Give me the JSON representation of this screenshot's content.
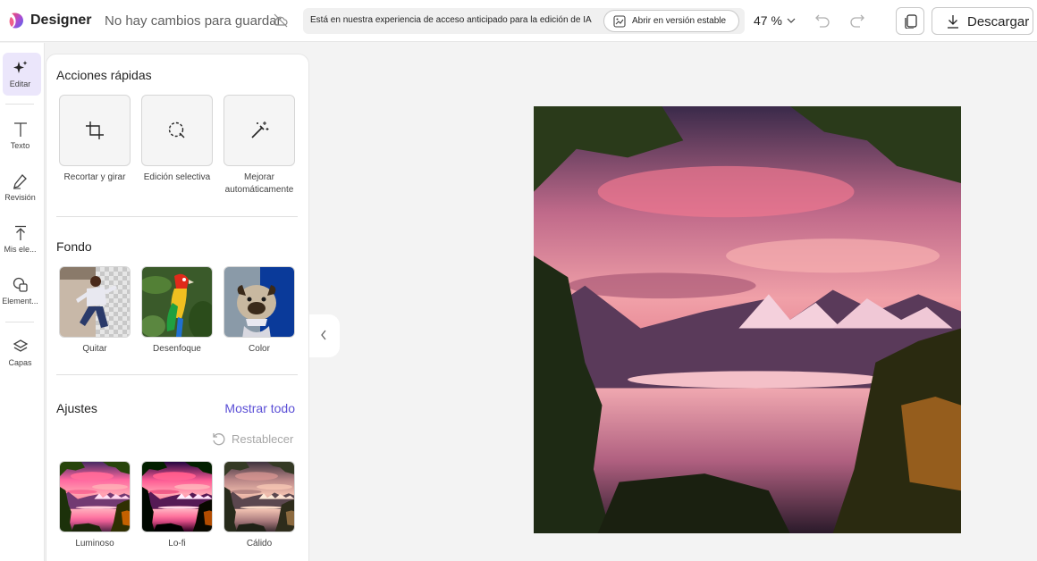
{
  "header": {
    "app_name": "Designer",
    "save_status": "No hay cambios para guardar",
    "notice_text": "Está en nuestra experiencia de acceso anticipado para la edición de IA",
    "stable_button": "Abrir en versión estable",
    "zoom": "47 %",
    "download": "Descargar"
  },
  "rail": {
    "items": [
      {
        "label": "Editar",
        "icon": "sparkle-icon",
        "active": true
      },
      {
        "label": "Texto",
        "icon": "text-icon"
      },
      {
        "label": "Revisión",
        "icon": "pen-icon"
      },
      {
        "label": "Mis ele...",
        "icon": "upload-icon"
      },
      {
        "label": "Element...",
        "icon": "shapes-icon"
      },
      {
        "label": "Capas",
        "icon": "layers-icon"
      }
    ]
  },
  "panel": {
    "quick_actions": {
      "title": "Acciones rápidas",
      "items": [
        {
          "label": "Recortar y girar",
          "icon": "crop-icon"
        },
        {
          "label": "Edición selectiva",
          "icon": "lasso-icon"
        },
        {
          "label": "Mejorar automáticamente",
          "icon": "magic-wand-icon"
        }
      ]
    },
    "background": {
      "title": "Fondo",
      "items": [
        {
          "label": "Quitar"
        },
        {
          "label": "Desenfoque"
        },
        {
          "label": "Color"
        }
      ]
    },
    "adjustments": {
      "title": "Ajustes",
      "show_all": "Mostrar todo",
      "reset": "Restablecer",
      "filters": [
        {
          "label": "Luminoso"
        },
        {
          "label": "Lo-fi"
        },
        {
          "label": "Cálido"
        }
      ]
    }
  },
  "colors": {
    "accent": "#5b4fd6",
    "active_rail_bg": "#ebe6fb"
  }
}
